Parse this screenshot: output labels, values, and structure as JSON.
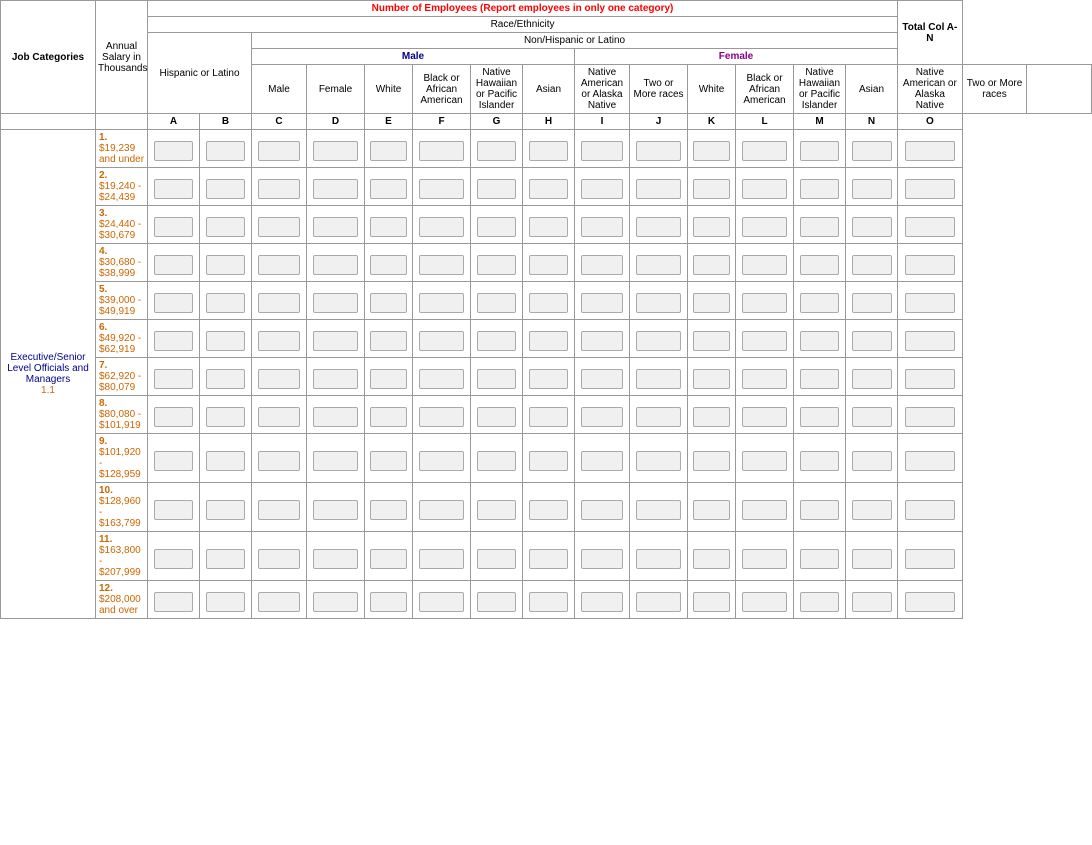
{
  "table": {
    "main_header": "Number of Employees (Report employees in only one category)",
    "race_header": "Race/Ethnicity",
    "non_hispanic_header": "Non/Hispanic or Latino",
    "hispanic_header": "Hispanic or Latino",
    "male_header": "Male",
    "female_header": "Female",
    "total_col_header": "Total Col A-N",
    "annual_salary": "Annual Salary in Thousands",
    "job_categories": "Job Categories",
    "col_headers": {
      "A": "A",
      "B": "B",
      "C": "C",
      "D": "D",
      "E": "E",
      "F": "F",
      "G": "G",
      "H": "H",
      "I": "I",
      "J": "J",
      "K": "K",
      "L": "L",
      "M": "M",
      "N": "N",
      "O": "O"
    },
    "sub_headers": {
      "male_A": "Male",
      "male_B": "Female",
      "male_C": "White",
      "male_D": "Black or African American",
      "male_E": "Native Hawaiian or Pacific Islander",
      "male_F": "Asian",
      "male_G": "Native American or Alaska Native",
      "male_H": "Two or More races",
      "female_I": "White",
      "female_J": "Black or African American",
      "female_K": "Native Hawaiian or Pacific Islander",
      "female_L": "Asian",
      "female_M": "Native American or Alaska Native",
      "female_N": "Two or More races"
    },
    "salary_rows": [
      {
        "num": "1.",
        "range": "$19,239 and under"
      },
      {
        "num": "2.",
        "range": "$19,240 - $24,439"
      },
      {
        "num": "3.",
        "range": "$24,440 - $30,679"
      },
      {
        "num": "4.",
        "range": "$30,680 - $38,999"
      },
      {
        "num": "5.",
        "range": "$39,000 - $49,919"
      },
      {
        "num": "6.",
        "range": "$49,920 - $62,919"
      },
      {
        "num": "7.",
        "range": "$62,920 - $80,079"
      },
      {
        "num": "8.",
        "range": "$80,080 - $101,919"
      },
      {
        "num": "9.",
        "range": "$101,920 - $128,959"
      },
      {
        "num": "10.",
        "range": "$128,960 - $163,799"
      },
      {
        "num": "11.",
        "range": "$163,800 - $207,999"
      },
      {
        "num": "12.",
        "range": "$208,000 and over"
      }
    ],
    "job_cat_label": "Executive/Senior Level Officials and Managers",
    "job_cat_number": "1.1"
  }
}
